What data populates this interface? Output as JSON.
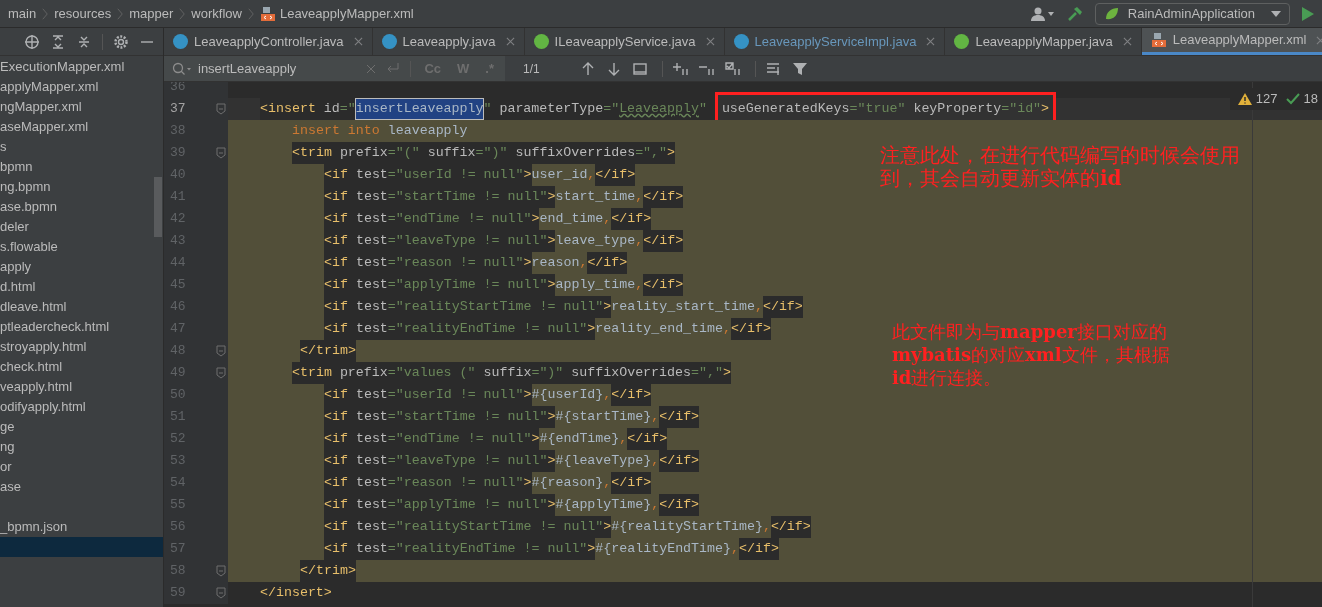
{
  "breadcrumbs": [
    {
      "label": "main",
      "kind": "folder"
    },
    {
      "label": "resources",
      "kind": "folder"
    },
    {
      "label": "mapper",
      "kind": "folder"
    },
    {
      "label": "workflow",
      "kind": "folder"
    },
    {
      "label": "LeaveapplyMapper.xml",
      "kind": "xml"
    }
  ],
  "run_config": {
    "label": "RainAdminApplication"
  },
  "tabs": [
    {
      "label": "LeaveapplyController.java",
      "kind": "class",
      "selected": false,
      "modified": false
    },
    {
      "label": "Leaveapply.java",
      "kind": "class",
      "selected": false,
      "modified": false
    },
    {
      "label": "ILeaveapplyService.java",
      "kind": "interface",
      "selected": false,
      "modified": false
    },
    {
      "label": "LeaveapplyServiceImpl.java",
      "kind": "class",
      "selected": false,
      "modified": true
    },
    {
      "label": "LeaveapplyMapper.java",
      "kind": "interface",
      "selected": false,
      "modified": false
    },
    {
      "label": "LeaveapplyMapper.xml",
      "kind": "xml",
      "selected": true,
      "modified": false
    }
  ],
  "sidebar": {
    "items": [
      {
        "label": "ExecutionMapper.xml",
        "selected": false
      },
      {
        "label": "applyMapper.xml",
        "selected": false
      },
      {
        "label": "ngMapper.xml",
        "selected": false
      },
      {
        "label": "aseMapper.xml",
        "selected": false
      },
      {
        "label": "s",
        "selected": false
      },
      {
        "label": "bpmn",
        "selected": false
      },
      {
        "label": "ng.bpmn",
        "selected": false
      },
      {
        "label": "ase.bpmn",
        "selected": false
      },
      {
        "label": "deler",
        "selected": false
      },
      {
        "label": "s.flowable",
        "selected": false
      },
      {
        "label": "apply",
        "selected": false
      },
      {
        "label": "d.html",
        "selected": false
      },
      {
        "label": "dleave.html",
        "selected": false
      },
      {
        "label": "ptleadercheck.html",
        "selected": false
      },
      {
        "label": "stroyapply.html",
        "selected": false
      },
      {
        "label": "check.html",
        "selected": false
      },
      {
        "label": "veapply.html",
        "selected": false
      },
      {
        "label": "odifyapply.html",
        "selected": false
      },
      {
        "label": "ge",
        "selected": false
      },
      {
        "label": "ng",
        "selected": false
      },
      {
        "label": "or",
        "selected": false
      },
      {
        "label": "ase",
        "selected": false
      },
      {
        "selected": false
      },
      {
        "label": "_bpmn.json",
        "selected": false
      },
      {
        "selected": true
      }
    ]
  },
  "search": {
    "value": "insertLeaveapply",
    "toggles": [
      "Cc",
      "W",
      ".*"
    ],
    "count": "1/1"
  },
  "inspections": {
    "warnings": "127",
    "checks": "18"
  },
  "code_lines": [
    {
      "number": "36",
      "current": false,
      "highlighted": false,
      "fold": false
    },
    {
      "number": "37",
      "current": true,
      "highlighted": false,
      "fold": true,
      "kind": "element",
      "segments": [
        {
          "kind": "markup",
          "tokens": [
            {
              "kind": "tag",
              "text": "<insert"
            },
            {
              "kind": "attr",
              "text": " id"
            },
            {
              "kind": "value",
              "text": "=\""
            },
            {
              "kind": "selected",
              "text": "insertLeaveapply"
            },
            {
              "kind": "value",
              "text": "\""
            },
            {
              "kind": "attr",
              "text": " parameterType"
            },
            {
              "kind": "value",
              "text": "=\""
            },
            {
              "kind": "squiggle",
              "text": "Leaveapply"
            },
            {
              "kind": "value",
              "text": "\" "
            }
          ]
        },
        {
          "kind": "boxed",
          "tokens": [
            {
              "kind": "attr",
              "text": "useGeneratedKeys"
            },
            {
              "kind": "value",
              "text": "=\"true\""
            },
            {
              "kind": "attr",
              "text": " keyProperty"
            },
            {
              "kind": "value",
              "text": "=\"id\""
            },
            {
              "kind": "tag",
              "text": ">"
            }
          ]
        }
      ]
    },
    {
      "number": "38",
      "current": false,
      "highlighted": true,
      "fold": false,
      "kind": "statement",
      "segments": [
        {
          "kind": "content",
          "tokens": [
            {
              "kind": "keyword",
              "text": "insert into"
            },
            {
              "kind": "text",
              "text": " leaveapply"
            }
          ]
        }
      ]
    },
    {
      "number": "39",
      "current": false,
      "highlighted": true,
      "fold": true,
      "kind": "statement",
      "segments": [
        {
          "kind": "markup",
          "tokens": [
            {
              "kind": "tag",
              "text": "<trim"
            },
            {
              "kind": "attr",
              "text": " prefix"
            },
            {
              "kind": "value",
              "text": "=\"(\""
            },
            {
              "kind": "attr",
              "text": " suffix"
            },
            {
              "kind": "value",
              "text": "=\")\""
            },
            {
              "kind": "attr",
              "text": " suffixOverrides"
            },
            {
              "kind": "value",
              "text": "=\",\""
            },
            {
              "kind": "tag",
              "text": ">"
            }
          ]
        }
      ]
    },
    {
      "number": "40",
      "current": false,
      "highlighted": true,
      "fold": false,
      "kind": "condition",
      "segments": [
        {
          "kind": "markup",
          "tokens": [
            {
              "kind": "tag",
              "text": "<if"
            },
            {
              "kind": "attr",
              "text": " test"
            },
            {
              "kind": "value",
              "text": "=\"userId != null\""
            },
            {
              "kind": "tag",
              "text": ">"
            }
          ]
        },
        {
          "kind": "content",
          "tokens": [
            {
              "kind": "text",
              "text": "user_id"
            },
            {
              "kind": "punct",
              "text": ","
            }
          ]
        },
        {
          "kind": "markup",
          "tokens": [
            {
              "kind": "tag",
              "text": "</if>"
            }
          ]
        }
      ]
    },
    {
      "number": "41",
      "current": false,
      "highlighted": true,
      "fold": false,
      "kind": "condition",
      "segments": [
        {
          "kind": "markup",
          "tokens": [
            {
              "kind": "tag",
              "text": "<if"
            },
            {
              "kind": "attr",
              "text": " test"
            },
            {
              "kind": "value",
              "text": "=\"startTime != null\""
            },
            {
              "kind": "tag",
              "text": ">"
            }
          ]
        },
        {
          "kind": "content",
          "tokens": [
            {
              "kind": "text",
              "text": "start_time"
            },
            {
              "kind": "punct",
              "text": ","
            }
          ]
        },
        {
          "kind": "markup",
          "tokens": [
            {
              "kind": "tag",
              "text": "</if>"
            }
          ]
        }
      ]
    },
    {
      "number": "42",
      "current": false,
      "highlighted": true,
      "fold": false,
      "kind": "condition",
      "segments": [
        {
          "kind": "markup",
          "tokens": [
            {
              "kind": "tag",
              "text": "<if"
            },
            {
              "kind": "attr",
              "text": " test"
            },
            {
              "kind": "value",
              "text": "=\"endTime != null\""
            },
            {
              "kind": "tag",
              "text": ">"
            }
          ]
        },
        {
          "kind": "content",
          "tokens": [
            {
              "kind": "text",
              "text": "end_time"
            },
            {
              "kind": "punct",
              "text": ","
            }
          ]
        },
        {
          "kind": "markup",
          "tokens": [
            {
              "kind": "tag",
              "text": "</if>"
            }
          ]
        }
      ]
    },
    {
      "number": "43",
      "current": false,
      "highlighted": true,
      "fold": false,
      "kind": "condition",
      "segments": [
        {
          "kind": "markup",
          "tokens": [
            {
              "kind": "tag",
              "text": "<if"
            },
            {
              "kind": "attr",
              "text": " test"
            },
            {
              "kind": "value",
              "text": "=\"leaveType != null\""
            },
            {
              "kind": "tag",
              "text": ">"
            }
          ]
        },
        {
          "kind": "content",
          "tokens": [
            {
              "kind": "text",
              "text": "leave_type"
            },
            {
              "kind": "punct",
              "text": ","
            }
          ]
        },
        {
          "kind": "markup",
          "tokens": [
            {
              "kind": "tag",
              "text": "</if>"
            }
          ]
        }
      ]
    },
    {
      "number": "44",
      "current": false,
      "highlighted": true,
      "fold": false,
      "kind": "condition",
      "segments": [
        {
          "kind": "markup",
          "tokens": [
            {
              "kind": "tag",
              "text": "<if"
            },
            {
              "kind": "attr",
              "text": " test"
            },
            {
              "kind": "value",
              "text": "=\"reason != null\""
            },
            {
              "kind": "tag",
              "text": ">"
            }
          ]
        },
        {
          "kind": "content",
          "tokens": [
            {
              "kind": "text",
              "text": "reason"
            },
            {
              "kind": "punct",
              "text": ","
            }
          ]
        },
        {
          "kind": "markup",
          "tokens": [
            {
              "kind": "tag",
              "text": "</if>"
            }
          ]
        }
      ]
    },
    {
      "number": "45",
      "current": false,
      "highlighted": true,
      "fold": false,
      "kind": "condition",
      "segments": [
        {
          "kind": "markup",
          "tokens": [
            {
              "kind": "tag",
              "text": "<if"
            },
            {
              "kind": "attr",
              "text": " test"
            },
            {
              "kind": "value",
              "text": "=\"applyTime != null\""
            },
            {
              "kind": "tag",
              "text": ">"
            }
          ]
        },
        {
          "kind": "content",
          "tokens": [
            {
              "kind": "text",
              "text": "apply_time"
            },
            {
              "kind": "punct",
              "text": ","
            }
          ]
        },
        {
          "kind": "markup",
          "tokens": [
            {
              "kind": "tag",
              "text": "</if>"
            }
          ]
        }
      ]
    },
    {
      "number": "46",
      "current": false,
      "highlighted": true,
      "fold": false,
      "kind": "condition",
      "segments": [
        {
          "kind": "markup",
          "tokens": [
            {
              "kind": "tag",
              "text": "<if"
            },
            {
              "kind": "attr",
              "text": " test"
            },
            {
              "kind": "value",
              "text": "=\"realityStartTime != null\""
            },
            {
              "kind": "tag",
              "text": ">"
            }
          ]
        },
        {
          "kind": "content",
          "tokens": [
            {
              "kind": "text",
              "text": "reality_start_time"
            },
            {
              "kind": "punct",
              "text": ","
            }
          ]
        },
        {
          "kind": "markup",
          "tokens": [
            {
              "kind": "tag",
              "text": "</if>"
            }
          ]
        }
      ]
    },
    {
      "number": "47",
      "current": false,
      "highlighted": true,
      "fold": false,
      "kind": "condition",
      "segments": [
        {
          "kind": "markup",
          "tokens": [
            {
              "kind": "tag",
              "text": "<if"
            },
            {
              "kind": "attr",
              "text": " test"
            },
            {
              "kind": "value",
              "text": "=\"realityEndTime != null\""
            },
            {
              "kind": "tag",
              "text": ">"
            }
          ]
        },
        {
          "kind": "content",
          "tokens": [
            {
              "kind": "text",
              "text": "reality_end_time"
            },
            {
              "kind": "punct",
              "text": ","
            }
          ]
        },
        {
          "kind": "markup",
          "tokens": [
            {
              "kind": "tag",
              "text": "</if>"
            }
          ]
        }
      ]
    },
    {
      "number": "48",
      "current": false,
      "highlighted": true,
      "fold": true,
      "kind": "closing",
      "segments": [
        {
          "kind": "markup",
          "tokens": [
            {
              "kind": "tag",
              "text": "</trim>"
            }
          ]
        }
      ]
    },
    {
      "number": "49",
      "current": false,
      "highlighted": true,
      "fold": true,
      "kind": "statement",
      "segments": [
        {
          "kind": "markup",
          "tokens": [
            {
              "kind": "tag",
              "text": "<trim"
            },
            {
              "kind": "attr",
              "text": " prefix"
            },
            {
              "kind": "value",
              "text": "=\"values (\""
            },
            {
              "kind": "attr",
              "text": " suffix"
            },
            {
              "kind": "value",
              "text": "=\")\""
            },
            {
              "kind": "attr",
              "text": " suffixOverrides"
            },
            {
              "kind": "value",
              "text": "=\",\""
            },
            {
              "kind": "tag",
              "text": ">"
            }
          ]
        }
      ]
    },
    {
      "number": "50",
      "current": false,
      "highlighted": true,
      "fold": false,
      "kind": "condition",
      "segments": [
        {
          "kind": "markup",
          "tokens": [
            {
              "kind": "tag",
              "text": "<if"
            },
            {
              "kind": "attr",
              "text": " test"
            },
            {
              "kind": "value",
              "text": "=\"userId != null\""
            },
            {
              "kind": "tag",
              "text": ">"
            }
          ]
        },
        {
          "kind": "content",
          "tokens": [
            {
              "kind": "text",
              "text": "#{userId}"
            },
            {
              "kind": "punct",
              "text": ","
            }
          ]
        },
        {
          "kind": "markup",
          "tokens": [
            {
              "kind": "tag",
              "text": "</if>"
            }
          ]
        }
      ]
    },
    {
      "number": "51",
      "current": false,
      "highlighted": true,
      "fold": false,
      "kind": "condition",
      "segments": [
        {
          "kind": "markup",
          "tokens": [
            {
              "kind": "tag",
              "text": "<if"
            },
            {
              "kind": "attr",
              "text": " test"
            },
            {
              "kind": "value",
              "text": "=\"startTime != null\""
            },
            {
              "kind": "tag",
              "text": ">"
            }
          ]
        },
        {
          "kind": "content",
          "tokens": [
            {
              "kind": "text",
              "text": "#{startTime}"
            },
            {
              "kind": "punct",
              "text": ","
            }
          ]
        },
        {
          "kind": "markup",
          "tokens": [
            {
              "kind": "tag",
              "text": "</if>"
            }
          ]
        }
      ]
    },
    {
      "number": "52",
      "current": false,
      "highlighted": true,
      "fold": false,
      "kind": "condition",
      "segments": [
        {
          "kind": "markup",
          "tokens": [
            {
              "kind": "tag",
              "text": "<if"
            },
            {
              "kind": "attr",
              "text": " test"
            },
            {
              "kind": "value",
              "text": "=\"endTime != null\""
            },
            {
              "kind": "tag",
              "text": ">"
            }
          ]
        },
        {
          "kind": "content",
          "tokens": [
            {
              "kind": "text",
              "text": "#{endTime}"
            },
            {
              "kind": "punct",
              "text": ","
            }
          ]
        },
        {
          "kind": "markup",
          "tokens": [
            {
              "kind": "tag",
              "text": "</if>"
            }
          ]
        }
      ]
    },
    {
      "number": "53",
      "current": false,
      "highlighted": true,
      "fold": false,
      "kind": "condition",
      "segments": [
        {
          "kind": "markup",
          "tokens": [
            {
              "kind": "tag",
              "text": "<if"
            },
            {
              "kind": "attr",
              "text": " test"
            },
            {
              "kind": "value",
              "text": "=\"leaveType != null\""
            },
            {
              "kind": "tag",
              "text": ">"
            }
          ]
        },
        {
          "kind": "content",
          "tokens": [
            {
              "kind": "text",
              "text": "#{leaveType}"
            },
            {
              "kind": "punct",
              "text": ","
            }
          ]
        },
        {
          "kind": "markup",
          "tokens": [
            {
              "kind": "tag",
              "text": "</if>"
            }
          ]
        }
      ]
    },
    {
      "number": "54",
      "current": false,
      "highlighted": true,
      "fold": false,
      "kind": "condition",
      "segments": [
        {
          "kind": "markup",
          "tokens": [
            {
              "kind": "tag",
              "text": "<if"
            },
            {
              "kind": "attr",
              "text": " test"
            },
            {
              "kind": "value",
              "text": "=\"reason != null\""
            },
            {
              "kind": "tag",
              "text": ">"
            }
          ]
        },
        {
          "kind": "content",
          "tokens": [
            {
              "kind": "text",
              "text": "#{reason}"
            },
            {
              "kind": "punct",
              "text": ","
            }
          ]
        },
        {
          "kind": "markup",
          "tokens": [
            {
              "kind": "tag",
              "text": "</if>"
            }
          ]
        }
      ]
    },
    {
      "number": "55",
      "current": false,
      "highlighted": true,
      "fold": false,
      "kind": "condition",
      "segments": [
        {
          "kind": "markup",
          "tokens": [
            {
              "kind": "tag",
              "text": "<if"
            },
            {
              "kind": "attr",
              "text": " test"
            },
            {
              "kind": "value",
              "text": "=\"applyTime != null\""
            },
            {
              "kind": "tag",
              "text": ">"
            }
          ]
        },
        {
          "kind": "content",
          "tokens": [
            {
              "kind": "text",
              "text": "#{applyTime}"
            },
            {
              "kind": "punct",
              "text": ","
            }
          ]
        },
        {
          "kind": "markup",
          "tokens": [
            {
              "kind": "tag",
              "text": "</if>"
            }
          ]
        }
      ]
    },
    {
      "number": "56",
      "current": false,
      "highlighted": true,
      "fold": false,
      "kind": "condition",
      "segments": [
        {
          "kind": "markup",
          "tokens": [
            {
              "kind": "tag",
              "text": "<if"
            },
            {
              "kind": "attr",
              "text": " test"
            },
            {
              "kind": "value",
              "text": "=\"realityStartTime != null\""
            },
            {
              "kind": "tag",
              "text": ">"
            }
          ]
        },
        {
          "kind": "content",
          "tokens": [
            {
              "kind": "text",
              "text": "#{realityStartTime}"
            },
            {
              "kind": "punct",
              "text": ","
            }
          ]
        },
        {
          "kind": "markup",
          "tokens": [
            {
              "kind": "tag",
              "text": "</if>"
            }
          ]
        }
      ]
    },
    {
      "number": "57",
      "current": false,
      "highlighted": true,
      "fold": false,
      "kind": "condition",
      "segments": [
        {
          "kind": "markup",
          "tokens": [
            {
              "kind": "tag",
              "text": "<if"
            },
            {
              "kind": "attr",
              "text": " test"
            },
            {
              "kind": "value",
              "text": "=\"realityEndTime != null\""
            },
            {
              "kind": "tag",
              "text": ">"
            }
          ]
        },
        {
          "kind": "content",
          "tokens": [
            {
              "kind": "text",
              "text": "#{realityEndTime}"
            },
            {
              "kind": "punct",
              "text": ","
            }
          ]
        },
        {
          "kind": "markup",
          "tokens": [
            {
              "kind": "tag",
              "text": "</if>"
            }
          ]
        }
      ]
    },
    {
      "number": "58",
      "current": false,
      "highlighted": true,
      "fold": true,
      "kind": "closing",
      "segments": [
        {
          "kind": "markup",
          "tokens": [
            {
              "kind": "tag",
              "text": "</trim>"
            }
          ]
        }
      ]
    },
    {
      "number": "59",
      "current": false,
      "highlighted": false,
      "fold": true,
      "kind": "element",
      "segments": [
        {
          "kind": "markup",
          "tokens": [
            {
              "kind": "tag",
              "text": "</insert>"
            }
          ]
        }
      ]
    }
  ],
  "annotations": [
    "注意此处，在进行代码编写的时候会使用到，其会自动更新实体的**id**",
    "此文件即为与**mapper**接口对应的**mybatis**的对应**xml**文件，其根据**id**进行连接。"
  ]
}
